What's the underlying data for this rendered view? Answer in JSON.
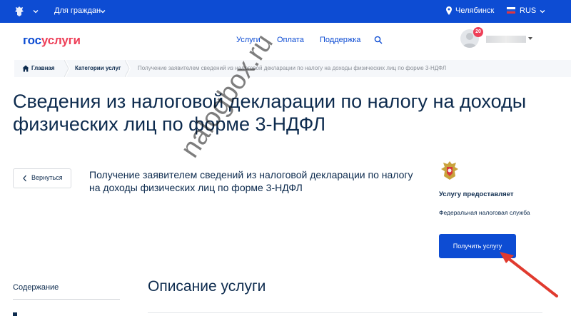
{
  "topbar": {
    "audience": "Для граждан",
    "city": "Челябинск",
    "language": "RUS"
  },
  "header": {
    "logo_part1": "гос",
    "logo_part2": "услуги",
    "nav": [
      "Услуги",
      "Оплата",
      "Поддержка"
    ],
    "notifications_count": "20"
  },
  "breadcrumb": {
    "home": "Главная",
    "categories": "Категории услуг",
    "current": "Получение заявителем сведений из налоговой декларации по налогу на доходы физических лиц по форме 3-НДФЛ"
  },
  "page_title": "Сведения из налоговой декларации по налогу на доходы физических лиц по форме 3-НДФЛ",
  "back_label": "Вернуться",
  "service_title": "Получение заявителем сведений из налоговой декларации по налогу на доходы физических лиц по форме 3-НДФЛ",
  "sidebar": {
    "provides_label": "Услугу предоставляет",
    "provider": "Федеральная налоговая служба",
    "get_service_button": "Получить услугу"
  },
  "contents_label": "Содержание",
  "description_title": "Описание услуги",
  "watermark": "nalogbox.ru",
  "colors": {
    "primary": "#0d4cd3",
    "accent": "#ee3f58",
    "text": "#0d2b4e",
    "arrow": "#e03a2e"
  }
}
